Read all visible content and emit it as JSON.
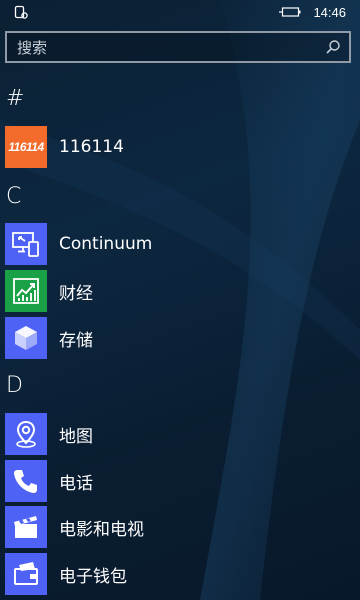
{
  "status_bar": {
    "time": "14:46",
    "left_icon": "notification-icon",
    "battery_icon": "battery-charging-icon"
  },
  "search": {
    "placeholder": "搜索"
  },
  "groups": [
    {
      "letter": "#",
      "apps": [
        {
          "name": "116114",
          "icon": "116114-logo",
          "tile_color": "#f26b2a",
          "logo_text": "116114"
        }
      ]
    },
    {
      "letter": "C",
      "apps": [
        {
          "name": "Continuum",
          "icon": "continuum-icon",
          "tile_color": "#4e63f5"
        },
        {
          "name": "财经",
          "icon": "finance-chart-icon",
          "tile_color": "#1aa046"
        },
        {
          "name": "存储",
          "icon": "storage-cube-icon",
          "tile_color": "#4e63f5"
        }
      ]
    },
    {
      "letter": "D",
      "apps": [
        {
          "name": "地图",
          "icon": "map-pin-icon",
          "tile_color": "#4e63f5"
        },
        {
          "name": "电话",
          "icon": "phone-icon",
          "tile_color": "#4e63f5"
        },
        {
          "name": "电影和电视",
          "icon": "clapperboard-icon",
          "tile_color": "#4e63f5"
        },
        {
          "name": "电子钱包",
          "icon": "wallet-icon",
          "tile_color": "#4e63f5"
        }
      ]
    }
  ]
}
